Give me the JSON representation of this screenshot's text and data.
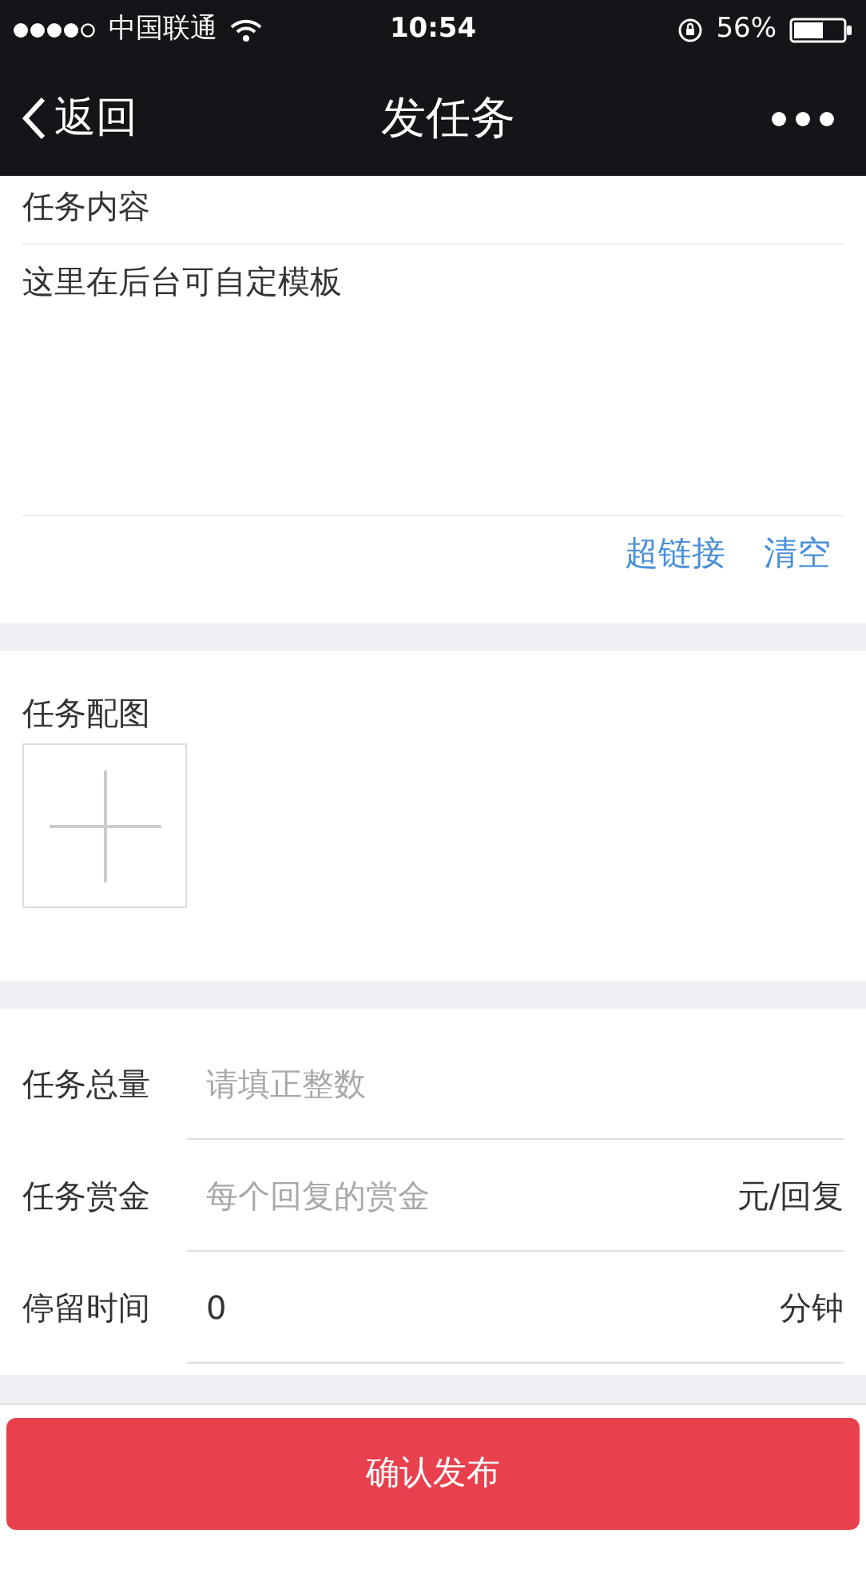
{
  "status_bar": {
    "carrier": "中国联通",
    "time": "10:54",
    "battery": "56%"
  },
  "nav": {
    "back": "返回",
    "title": "发任务"
  },
  "content": {
    "label": "任务内容",
    "text": "这里在后台可自定模板",
    "links": [
      "超链接",
      "清空"
    ]
  },
  "image": {
    "label": "任务配图"
  },
  "fields": [
    {
      "label": "任务总量",
      "placeholder": "请填正整数"
    },
    {
      "label": "任务赏金",
      "placeholder": "每个回复的赏金",
      "unit": "元/回复"
    },
    {
      "label": "停留时间",
      "value": "0",
      "unit": "分钟"
    }
  ],
  "submit": "确认发布"
}
